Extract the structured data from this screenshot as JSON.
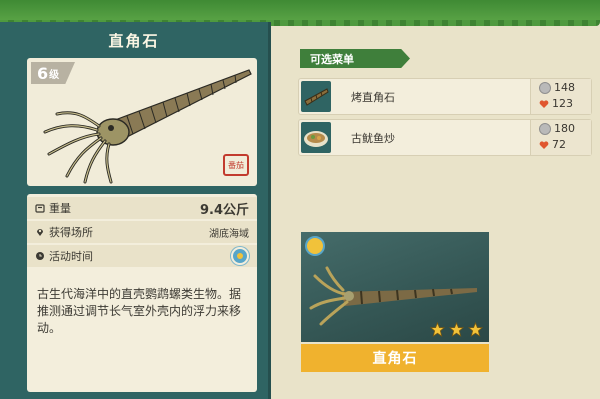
{
  "creature": {
    "title": "直角石",
    "level_number": "6",
    "level_unit": "级",
    "seal_text": "番茄",
    "weight_label": "重量",
    "weight_value": "9.4公斤",
    "location_label": "获得场所",
    "location_value": "湖底海域",
    "time_label": "活动时间",
    "description": "古生代海洋中的直壳鹦鹉螺类生物。据推测通过调节长气室外壳内的浮力来移动。"
  },
  "menu": {
    "tag_label": "可选菜单",
    "dishes": [
      {
        "name": "烤直角石",
        "coin": "148",
        "heart": "123"
      },
      {
        "name": "古鱿鱼炒",
        "coin": "180",
        "heart": "72"
      }
    ]
  },
  "preview": {
    "name": "直角石",
    "stars": 3
  },
  "colors": {
    "panel_teal": "#2f6463",
    "menu_green": "#3f7f3b",
    "name_bar_orange": "#f0b22e",
    "grass_green": "#4f9a3f"
  },
  "icons": [
    "scale-icon",
    "location-pin-icon",
    "clock-icon",
    "sun-icon",
    "coin-icon",
    "heart-icon",
    "star-icon"
  ]
}
